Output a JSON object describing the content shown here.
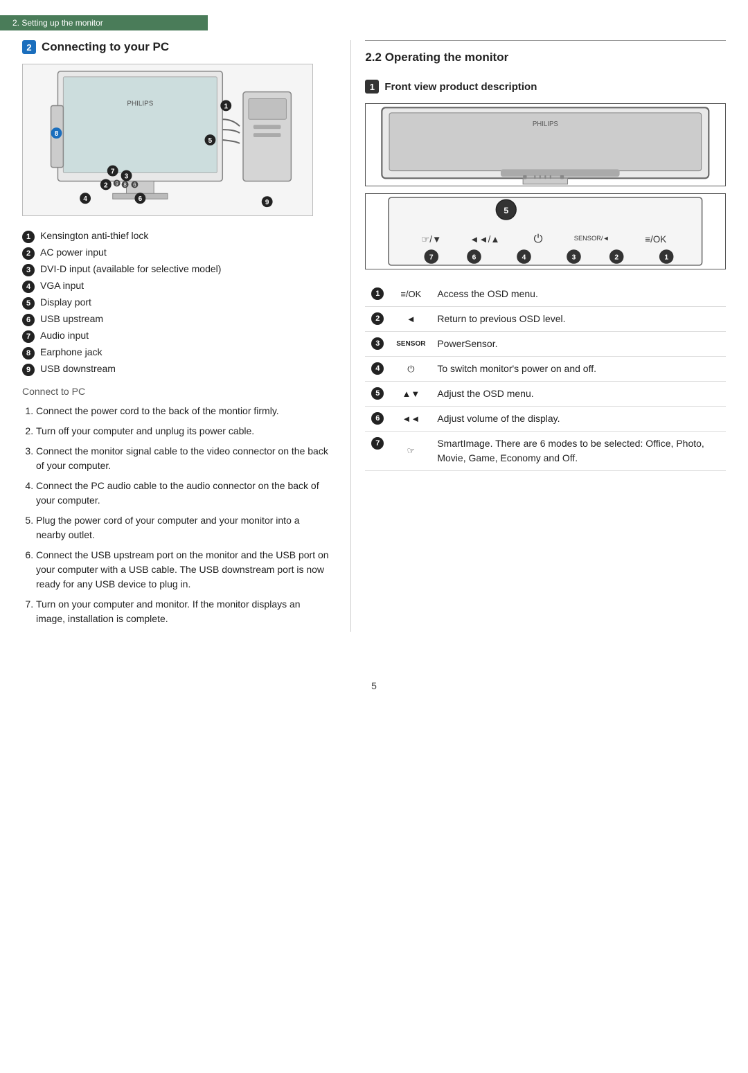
{
  "header": {
    "label": "2. Setting up the monitor"
  },
  "left": {
    "section_badge": "2",
    "section_title": "Connecting to your PC",
    "parts_list": [
      {
        "num": "1",
        "label": "Kensington anti-thief lock"
      },
      {
        "num": "2",
        "label": "AC power input"
      },
      {
        "num": "3",
        "label": "DVI-D input (available for selective model)"
      },
      {
        "num": "4",
        "label": "VGA input"
      },
      {
        "num": "5",
        "label": "Display port"
      },
      {
        "num": "6",
        "label": "USB upstream"
      },
      {
        "num": "7",
        "label": "Audio input"
      },
      {
        "num": "8",
        "label": "Earphone jack"
      },
      {
        "num": "9",
        "label": "USB downstream"
      }
    ],
    "connect_to_pc": "Connect to PC",
    "steps": [
      "Connect the power cord to the back of the montior firmly.",
      "Turn off your computer and unplug its power cable.",
      "Connect the monitor signal cable to the video connector on the back of your computer.",
      "Connect the PC audio cable to the audio connector on the back of your computer.",
      "Plug the power cord of your computer and your monitor into a nearby outlet.",
      "Connect the USB upstream port on the monitor and the USB port on your computer with a USB cable. The USB downstream port is now ready for any USB device to plug in.",
      "Turn on your computer and monitor. If the monitor displays an image, installation is complete."
    ]
  },
  "right": {
    "section_title": "2.2 Operating the monitor",
    "front_view_badge": "1",
    "front_view_title": "Front view product description",
    "controls": [
      {
        "num": "1",
        "icon": "≡/OK",
        "desc": "Access the OSD menu."
      },
      {
        "num": "2",
        "icon": "◄",
        "desc": "Return to previous OSD level."
      },
      {
        "num": "3",
        "icon": "SENSOR",
        "desc": "PowerSensor."
      },
      {
        "num": "4",
        "icon": "⏻",
        "desc": "To switch monitor's power on and off."
      },
      {
        "num": "5",
        "icon": "▲▼",
        "desc": "Adjust the OSD menu."
      },
      {
        "num": "6",
        "icon": "◄◄",
        "desc": "Adjust volume of the display."
      },
      {
        "num": "7",
        "icon": "☞",
        "desc": "SmartImage. There are 6 modes to be selected: Office, Photo, Movie, Game, Economy and Off."
      }
    ]
  },
  "page_number": "5"
}
